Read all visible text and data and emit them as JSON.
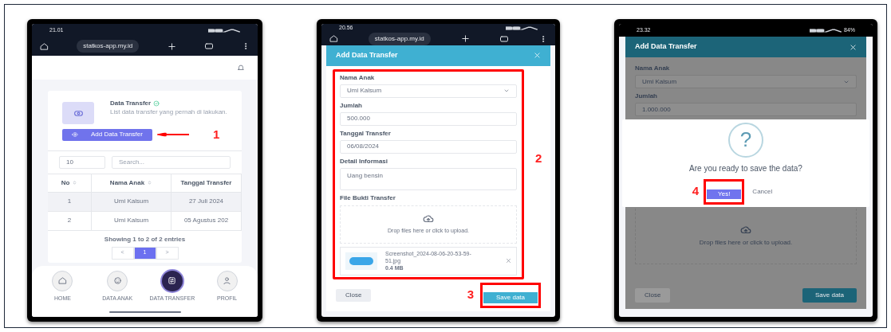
{
  "list_screen": {
    "status_time": "21.01",
    "url": "statkos-app.my.id",
    "card": {
      "title": "Data Transfer",
      "description": "List data transfer yang pernah di lakukan.",
      "button": "Add Data Transfer"
    },
    "callout": "1",
    "page_length": "10",
    "search_placeholder": "Search...",
    "columns": [
      "No",
      "Nama Anak",
      "Tanggal Transfer"
    ],
    "rows": [
      [
        "1",
        "Umi Kalsum",
        "27 Juli 2024"
      ],
      [
        "2",
        "Umi Kalsum",
        "05 Agustus 202"
      ]
    ],
    "entries": "Showing 1 to 2 of 2 entries",
    "pages": [
      {
        "label": "<",
        "selected": false
      },
      {
        "label": "1",
        "selected": true
      },
      {
        "label": ">",
        "selected": false
      }
    ],
    "nav": [
      {
        "label": "HOME",
        "kind": "home",
        "selected": false
      },
      {
        "label": "DATA ANAK",
        "kind": "child",
        "selected": false
      },
      {
        "label": "DATA TRANSFER",
        "kind": "transfer",
        "selected": true
      },
      {
        "label": "PROFIL",
        "kind": "user",
        "selected": false
      }
    ]
  },
  "form_screen": {
    "status_time": "20.56",
    "url": "statkos-app.my.id",
    "title": "Add Data Transfer",
    "fields": [
      {
        "label": "Nama Anak",
        "value": "Umi Kalsum",
        "kind": "select"
      },
      {
        "label": "Jumlah",
        "value": "500.000",
        "kind": "text"
      },
      {
        "label": "Tanggal Transfer",
        "value": "06/08/2024",
        "kind": "text"
      },
      {
        "label": "Detail Informasi",
        "value": "Uang bensin",
        "kind": "textarea"
      }
    ],
    "file_label": "File Bukti Transfer",
    "dropzone": "Drop files here or click to upload.",
    "file": {
      "name": "Screenshot_2024-08-06-20-53-59-51.jpg",
      "size": "0.4 MB"
    },
    "callout_fields": "2",
    "callout_save": "3",
    "close_button": "Close",
    "save_button": "Save data"
  },
  "confirm_screen": {
    "status_time": "23.32",
    "battery": "84%",
    "title": "Add Data Transfer",
    "fields": [
      {
        "label": "Nama Anak",
        "value": "Umi Kalsum",
        "kind": "select"
      },
      {
        "label": "Jumlah",
        "value": "1.000.000",
        "kind": "text"
      }
    ],
    "dialog": {
      "symbol": "?",
      "message": "Are you ready to save the data?",
      "confirm": "Yes!",
      "cancel": "Cancel",
      "callout": "4"
    },
    "dropzone": "Drop files here or click to upload.",
    "close_button": "Close",
    "save_button": "Save data"
  }
}
